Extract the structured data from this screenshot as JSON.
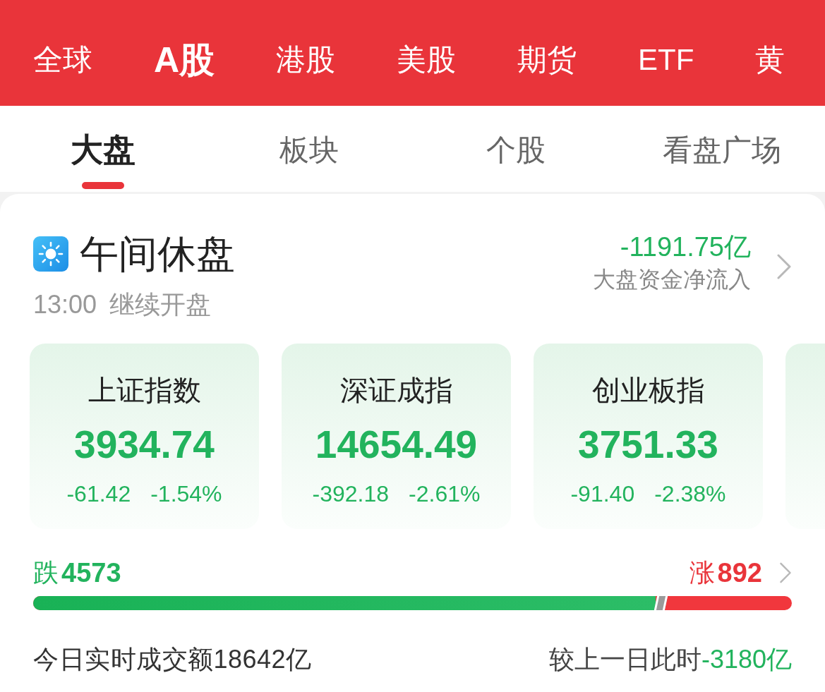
{
  "market_tabs": [
    {
      "label": "全球",
      "selected": false
    },
    {
      "label": "A股",
      "selected": true
    },
    {
      "label": "港股",
      "selected": false
    },
    {
      "label": "美股",
      "selected": false
    },
    {
      "label": "期货",
      "selected": false
    },
    {
      "label": "ETF",
      "selected": false
    },
    {
      "label": "黄",
      "selected": false
    }
  ],
  "sub_tabs": [
    {
      "label": "大盘",
      "selected": true
    },
    {
      "label": "板块",
      "selected": false
    },
    {
      "label": "个股",
      "selected": false
    },
    {
      "label": "看盘广场",
      "selected": false
    }
  ],
  "session": {
    "title": "午间休盘",
    "time": "13:00",
    "note": "继续开盘"
  },
  "net_inflow": {
    "value": "-1191.75亿",
    "label": "大盘资金净流入",
    "falling": true
  },
  "indices": [
    {
      "name": "上证指数",
      "value": "3934.74",
      "change": "-61.42",
      "percent": "-1.54%",
      "falling": true
    },
    {
      "name": "深证成指",
      "value": "14654.49",
      "change": "-392.18",
      "percent": "-2.61%",
      "falling": true
    },
    {
      "name": "创业板指",
      "value": "3751.33",
      "change": "-91.40",
      "percent": "-2.38%",
      "falling": true
    },
    {
      "falling": true
    }
  ],
  "breadth": {
    "fall_label": "跌",
    "fall_count": "4573",
    "rise_label": "涨",
    "rise_count": "892",
    "level": 0.82
  },
  "turnover": {
    "label": "今日实时成交额18642亿",
    "compare_label": "较上一日此时",
    "compare_value": "-3180亿",
    "falling": true
  }
}
